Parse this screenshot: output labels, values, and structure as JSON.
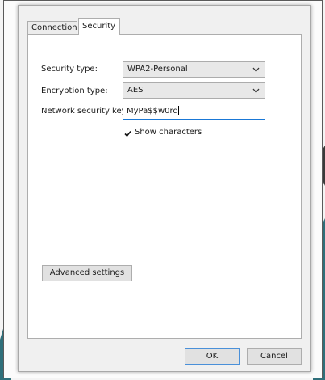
{
  "tabs": [
    {
      "label": "Connection"
    },
    {
      "label": "Security"
    }
  ],
  "active_tab": "Security",
  "form": {
    "security_type": {
      "label": "Security type:",
      "value": "WPA2-Personal"
    },
    "encryption_type": {
      "label": "Encryption type:",
      "value": "AES"
    },
    "network_key": {
      "label": "Network security key",
      "value": "MyPa$$w0rd"
    },
    "show_characters": {
      "label": "Show characters",
      "checked": true
    }
  },
  "buttons": {
    "advanced": "Advanced settings",
    "ok": "OK",
    "cancel": "Cancel"
  },
  "colors": {
    "focus_border": "#1a78d6",
    "dialog_bg": "#f0f0f0",
    "background_accent": "#2f6f7a"
  },
  "icons": {
    "dropdown": "chevron-down-icon",
    "check": "checkmark-icon"
  }
}
